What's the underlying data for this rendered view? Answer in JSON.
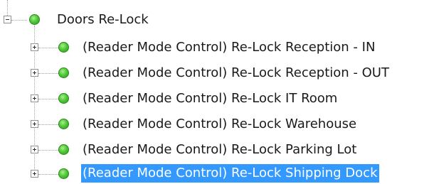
{
  "tree": {
    "root": {
      "label": "Doors Re-Lock",
      "expanded": true,
      "status": "online",
      "status_color": "#4cc238"
    },
    "children": [
      {
        "label": "(Reader Mode Control) Re-Lock Reception - IN",
        "expanded": false,
        "status": "online",
        "selected": false
      },
      {
        "label": "(Reader Mode Control) Re-Lock Reception - OUT",
        "expanded": false,
        "status": "online",
        "selected": false
      },
      {
        "label": "(Reader Mode Control) Re-Lock IT Room",
        "expanded": false,
        "status": "online",
        "selected": false
      },
      {
        "label": "(Reader Mode Control) Re-Lock Warehouse",
        "expanded": false,
        "status": "online",
        "selected": false
      },
      {
        "label": "(Reader Mode Control) Re-Lock Parking Lot",
        "expanded": false,
        "status": "online",
        "selected": false
      },
      {
        "label": "(Reader Mode Control) Re-Lock Shipping Dock",
        "expanded": false,
        "status": "online",
        "selected": true
      }
    ],
    "selection_color": "#3399ff"
  }
}
